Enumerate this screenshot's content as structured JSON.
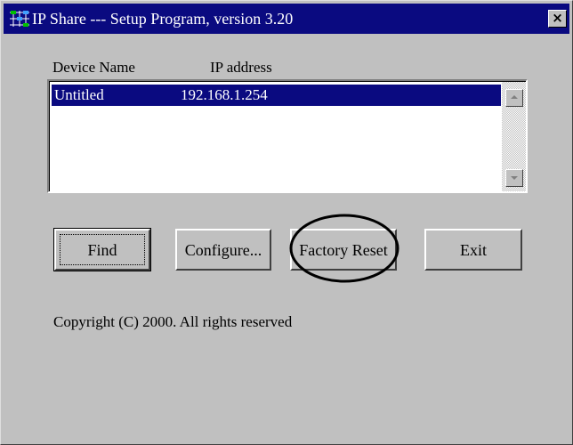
{
  "window": {
    "title": "IP Share --- Setup Program, version 3.20",
    "close_label": "×"
  },
  "list": {
    "headers": [
      "Device Name",
      "IP address"
    ],
    "rows": [
      {
        "device_name": "Untitled",
        "ip_address": "192.168.1.254"
      }
    ]
  },
  "buttons": {
    "find": "Find",
    "configure": "Configure...",
    "factory_reset": "Factory Reset",
    "exit": "Exit"
  },
  "footer": {
    "copyright": "Copyright (C) 2000.  All rights reserved"
  },
  "icons": {
    "app": "network-grid-icon",
    "close": "close-icon",
    "scroll_up": "scroll-up-arrow-icon",
    "scroll_down": "scroll-down-arrow-icon"
  },
  "colors": {
    "titlebar": "#0a0a80",
    "selection": "#0a0a80",
    "face": "#c0c0c0",
    "annotation": "#000000"
  }
}
